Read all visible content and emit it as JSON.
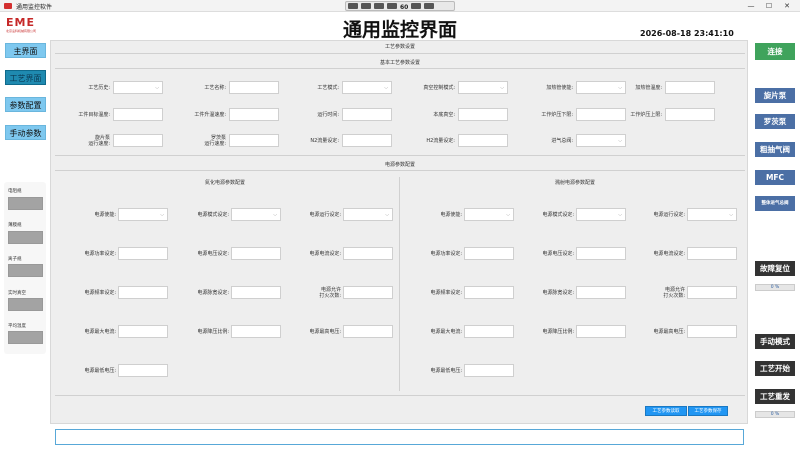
{
  "window": {
    "title": "通用监控软件",
    "toolbar_number": "60",
    "minimize": "—",
    "maximize": "☐",
    "close": "✕"
  },
  "logo": {
    "text": "EME",
    "subtitle": "北京凌科机械有限公司"
  },
  "header": {
    "title": "通用监控界面",
    "datetime": "2026-08-18 23:41:10"
  },
  "left_nav": {
    "items": [
      "主界面",
      "工艺界面",
      "参数配置",
      "手动参数"
    ],
    "active_index": 1
  },
  "left_gauges": [
    "电阻规",
    "薄膜规",
    "离子规",
    "实时真空",
    "平均温度"
  ],
  "panel": {
    "title": "工艺参数设置",
    "basic_title": "基本工艺参数设置",
    "basic_rows": [
      [
        {
          "label": "工艺历史:",
          "type": "select",
          "value": ""
        },
        {
          "label": "工艺名称:",
          "type": "input",
          "value": ""
        },
        {
          "label": "工艺模式:",
          "type": "select",
          "value": ""
        },
        {
          "label": "真空控制模式:",
          "type": "select",
          "value": ""
        },
        {
          "label": "加热管使能:",
          "type": "select",
          "value": ""
        },
        {
          "label": "加热管温度:",
          "type": "input",
          "value": ""
        }
      ],
      [
        {
          "label": "工件目标温度:",
          "type": "input",
          "value": ""
        },
        {
          "label": "工件升温速度:",
          "type": "input",
          "value": ""
        },
        {
          "label": "运行时间:",
          "type": "input",
          "value": ""
        },
        {
          "label": "本底真空:",
          "type": "input",
          "value": ""
        },
        {
          "label": "工作炉压下限:",
          "type": "input",
          "value": ""
        },
        {
          "label": "工作炉压上限:",
          "type": "input",
          "value": ""
        }
      ],
      [
        {
          "label": "旋片泵\n运行速度:",
          "type": "input",
          "value": ""
        },
        {
          "label": "罗茨泵\n运行速度:",
          "type": "input",
          "value": ""
        },
        {
          "label": "N2流量设定:",
          "type": "input",
          "value": ""
        },
        {
          "label": "H2流量设定:",
          "type": "input",
          "value": ""
        },
        {
          "label": "进气总阀:",
          "type": "select",
          "value": ""
        }
      ]
    ],
    "power_title": "电源参数配置",
    "left_power_title": "氮化电源参数配置",
    "right_power_title": "溅射电源参数配置",
    "left_power_rows": [
      [
        {
          "label": "电源使能:",
          "type": "select",
          "value": ""
        },
        {
          "label": "电源模式设定:",
          "type": "select",
          "value": ""
        },
        {
          "label": "电源运行设定:",
          "type": "select",
          "value": ""
        }
      ],
      [
        {
          "label": "电源功率设定:",
          "type": "input",
          "value": ""
        },
        {
          "label": "电源电压设定:",
          "type": "input",
          "value": ""
        },
        {
          "label": "电源电流设定:",
          "type": "input",
          "value": ""
        }
      ],
      [
        {
          "label": "电源频率设定:",
          "type": "input",
          "value": ""
        },
        {
          "label": "电源脉宽设定:",
          "type": "input",
          "value": ""
        },
        {
          "label": "电源允许\n打火次数:",
          "type": "input",
          "value": ""
        }
      ],
      [
        {
          "label": "电源最大电流:",
          "type": "input",
          "value": ""
        },
        {
          "label": "电源降压比例:",
          "type": "input",
          "value": ""
        },
        {
          "label": "电源最高电压:",
          "type": "input",
          "value": ""
        }
      ],
      [
        {
          "label": "电源最低电压:",
          "type": "input",
          "value": ""
        }
      ]
    ],
    "right_power_rows": [
      [
        {
          "label": "电源使能:",
          "type": "select",
          "value": ""
        },
        {
          "label": "电源模式设定:",
          "type": "select",
          "value": ""
        },
        {
          "label": "电源运行设定:",
          "type": "select",
          "value": ""
        }
      ],
      [
        {
          "label": "电源功率设定:",
          "type": "input",
          "value": ""
        },
        {
          "label": "电源电压设定:",
          "type": "input",
          "value": ""
        },
        {
          "label": "电源电流设定:",
          "type": "input",
          "value": ""
        }
      ],
      [
        {
          "label": "电源频率设定:",
          "type": "input",
          "value": ""
        },
        {
          "label": "电源脉宽设定:",
          "type": "input",
          "value": ""
        },
        {
          "label": "电源允许\n打火次数:",
          "type": "input",
          "value": ""
        }
      ],
      [
        {
          "label": "电源最大电流:",
          "type": "input",
          "value": ""
        },
        {
          "label": "电源降压比例:",
          "type": "input",
          "value": ""
        },
        {
          "label": "电源最高电压:",
          "type": "input",
          "value": ""
        }
      ],
      [
        {
          "label": "电源最低电压:",
          "type": "input",
          "value": ""
        }
      ]
    ],
    "buttons": {
      "read": "工艺参数读取",
      "save": "工艺参数保存"
    }
  },
  "right_panel": {
    "connect": "连接",
    "rotary_pump": "旋片泵",
    "roots_pump": "罗茨泵",
    "roughing_valve": "粗抽气阀",
    "mfc": "MFC",
    "main_inlet_valve": "整体进气总阀",
    "fault_reset": "故障复位",
    "progress1": "0 %",
    "manual_mode": "手动模式",
    "process_start": "工艺开始",
    "process_repeat": "工艺重发",
    "progress2": "0 %"
  },
  "colors": {
    "nav_button": "#7ec8ef",
    "nav_active": "#1f8ab0",
    "right_blue": "#4b6fa5",
    "right_dark": "#333333",
    "connect_green": "#3fa35c",
    "action_blue": "#2196f3"
  },
  "icons": {
    "app": "app-logo-icon",
    "select": "chevron-down-icon"
  }
}
